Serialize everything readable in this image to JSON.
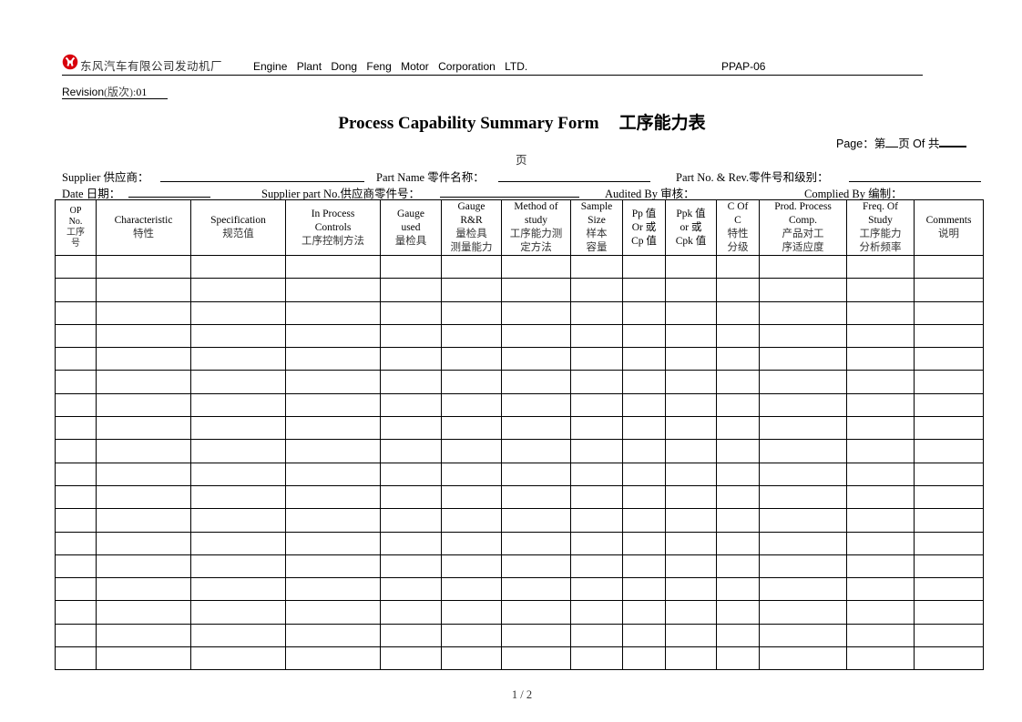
{
  "header": {
    "company_cn": "东风汽车有限公司发动机厂",
    "company_en": "Engine Plant Dong Feng Motor Corporation LTD.",
    "doc_code": "PPAP-06",
    "logo": "dongfeng-logo-icon",
    "brand_color": "#d8000c"
  },
  "revision": {
    "label": "Revision",
    "label_cn": "(版次):",
    "value": "01"
  },
  "title": {
    "en": "Process Capability Summary Form",
    "cn": "工序能力表"
  },
  "page_info": {
    "prefix": "Page：第",
    "mid": "页 Of 共",
    "wrap": "页"
  },
  "fields": {
    "supplier": "Supplier 供应商：",
    "part_name": "Part Name 零件名称：",
    "part_no_rev": "Part No. & Rev.零件号和级别：",
    "date": "Date 日期：",
    "supplier_part_no": "Supplier part No.供应商零件号：",
    "audited_by": "Audited By  审核：",
    "complied_by": "Complied By 编制："
  },
  "table": {
    "columns": [
      {
        "lines": [
          "OP",
          "No.",
          "工序",
          "号"
        ]
      },
      {
        "lines": [
          "Characteristic",
          "特性"
        ]
      },
      {
        "lines": [
          "Specification",
          "规范值"
        ]
      },
      {
        "lines": [
          "In Process",
          "Controls",
          "工序控制方法"
        ]
      },
      {
        "lines": [
          "Gauge",
          "used",
          "量检具"
        ]
      },
      {
        "lines": [
          "Gauge",
          "R&R",
          "量检具",
          "测量能力"
        ]
      },
      {
        "lines": [
          "Method of",
          "study",
          "工序能力测",
          "定方法"
        ]
      },
      {
        "lines": [
          "Sample",
          "Size",
          "样本",
          "容量"
        ]
      },
      {
        "lines": [
          "Pp 值",
          "Or 或",
          "Cp 值"
        ]
      },
      {
        "lines": [
          "Ppk 值",
          "or 或",
          "Cpk 值"
        ]
      },
      {
        "lines": [
          "C Of",
          "C",
          "特性",
          "分级"
        ]
      },
      {
        "lines": [
          "Prod. Process",
          "Comp.",
          "产品对工",
          "序适应度"
        ]
      },
      {
        "lines": [
          "Freq. Of",
          "Study",
          "工序能力",
          "分析频率"
        ]
      },
      {
        "lines": [
          "Comments",
          "说明"
        ]
      }
    ],
    "row_count": 18
  },
  "footer": {
    "page_number": "1 / 2"
  }
}
